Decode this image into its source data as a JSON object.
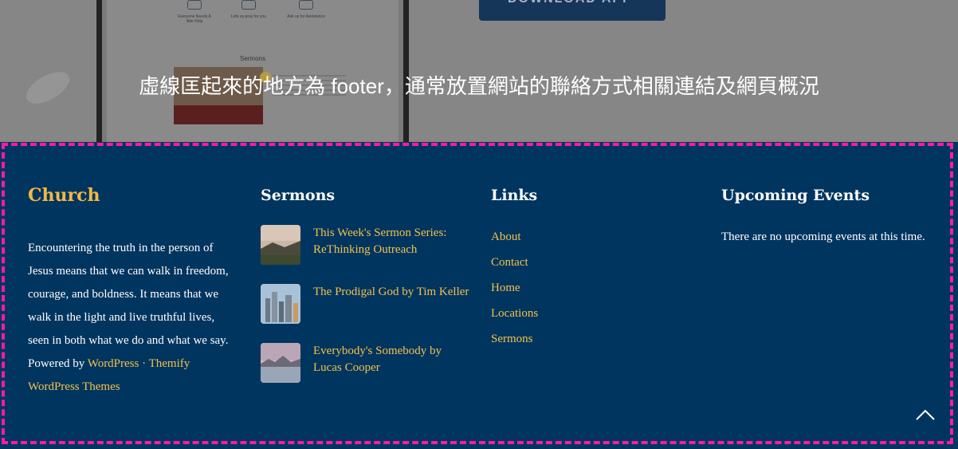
{
  "preview": {
    "icons": [
      {
        "label": "Everyone Needs A little Help"
      },
      {
        "label": "Lets us pray for you"
      },
      {
        "label": "Ask us for Assistance"
      }
    ],
    "sermons_label": "Sermons",
    "download_button": "DOWNLOAD APP"
  },
  "overlay_text": "虛線匡起來的地方為 footer，通常放置網站的聯絡方式相關連結及網頁概況",
  "footer": {
    "brand": "Church",
    "about_text": "Encountering the truth in the person of Jesus means that we can walk in freedom, courage, and boldness. It means that we walk in the light and live truthful lives, seen in both what we do and what we say.",
    "powered_prefix": "Powered by",
    "wordpress_link": "WordPress",
    "separator": "·",
    "themify_link": "Themify WordPress Themes",
    "sermons": {
      "title": "Sermons",
      "items": [
        {
          "title": "This Week's Sermon Series: ReThinking Outreach",
          "thumb": "landscape"
        },
        {
          "title": "The Prodigal God by Tim Keller",
          "thumb": "city"
        },
        {
          "title": "Everybody's Somebody by Lucas Cooper",
          "thumb": "lake"
        }
      ]
    },
    "links": {
      "title": "Links",
      "items": [
        "About",
        "Contact",
        "Home",
        "Locations",
        "Sermons"
      ]
    },
    "events": {
      "title": "Upcoming Events",
      "empty_text": "There are no upcoming events at this time."
    },
    "back_to_top_icon": "chevron-up-icon"
  },
  "colors": {
    "footer_bg": "#00355f",
    "accent": "#f3c14b",
    "dashed_border": "#ff1aa8"
  }
}
